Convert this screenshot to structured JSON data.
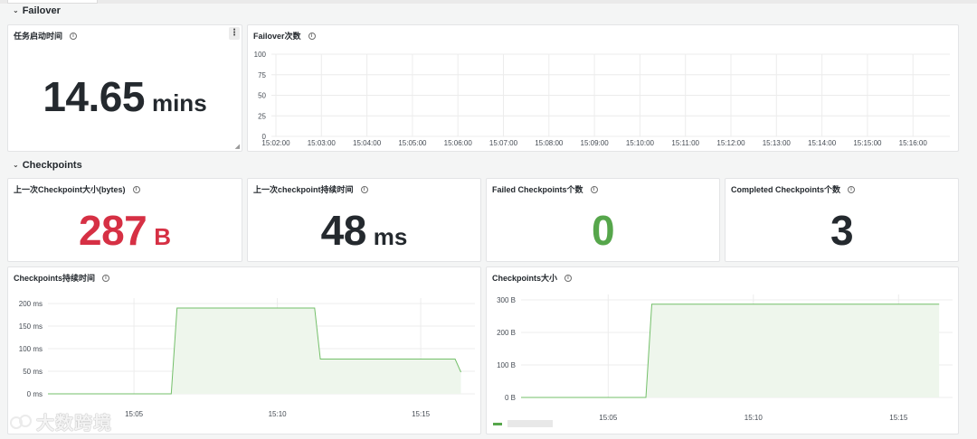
{
  "rows": {
    "failover": {
      "title": "Failover"
    },
    "checkpoints": {
      "title": "Checkpoints"
    }
  },
  "panels": {
    "job_start_time": {
      "title": "任务启动时间",
      "value": "14.65",
      "unit": "mins"
    },
    "failover_count": {
      "title": "Failover次数",
      "y_ticks": [
        "100",
        "75",
        "50",
        "25",
        "0"
      ],
      "x_ticks": [
        "15:02:00",
        "15:03:00",
        "15:04:00",
        "15:05:00",
        "15:06:00",
        "15:07:00",
        "15:08:00",
        "15:09:00",
        "15:10:00",
        "15:11:00",
        "15:12:00",
        "15:13:00",
        "15:14:00",
        "15:15:00",
        "15:16:00"
      ]
    },
    "last_cp_size": {
      "title": "上一次Checkpoint大小(bytes)",
      "value": "287",
      "unit": "B"
    },
    "last_cp_duration": {
      "title": "上一次checkpoint持续时间",
      "value": "48",
      "unit": "ms"
    },
    "failed_cps": {
      "title": "Failed Checkpoints个数",
      "value": "0"
    },
    "completed_cps": {
      "title": "Completed Checkpoints个数",
      "value": "3"
    },
    "cp_duration": {
      "title": "Checkpoints持续时间",
      "y_ticks": [
        "200 ms",
        "150 ms",
        "100 ms",
        "50 ms",
        "0 ms"
      ],
      "x_ticks": [
        "15:05",
        "15:10",
        "15:15"
      ]
    },
    "cp_size": {
      "title": "Checkpoints大小",
      "y_ticks": [
        "300 B",
        "200 B",
        "100 B",
        "0 B"
      ],
      "x_ticks": [
        "15:05",
        "15:10",
        "15:15"
      ]
    }
  },
  "colors": {
    "size_value": "#d63044",
    "failed_value": "#56a64b",
    "neutral_value": "#24292e",
    "series_line": "#73bf69",
    "series_fill": "#eef6ec"
  },
  "chart_data": [
    {
      "type": "line",
      "title": "Failover次数",
      "x": [
        "15:02:00",
        "15:03:00",
        "15:04:00",
        "15:05:00",
        "15:06:00",
        "15:07:00",
        "15:08:00",
        "15:09:00",
        "15:10:00",
        "15:11:00",
        "15:12:00",
        "15:13:00",
        "15:14:00",
        "15:15:00",
        "15:16:00"
      ],
      "series": [],
      "ylim": [
        0,
        100
      ],
      "grid": true
    },
    {
      "type": "area",
      "title": "Checkpoints持续时间",
      "x_minutes": [
        2.0,
        6.3,
        6.5,
        11.3,
        11.5,
        16.2,
        16.4
      ],
      "x_ref": "15:00",
      "values": [
        0,
        0,
        190,
        190,
        77,
        77,
        48
      ],
      "ylim": [
        0,
        200
      ],
      "yunit": "ms",
      "grid": true
    },
    {
      "type": "area",
      "title": "Checkpoints大小",
      "x_minutes": [
        2.0,
        6.3,
        6.5,
        16.4
      ],
      "x_ref": "15:00",
      "values": [
        0,
        0,
        287,
        287
      ],
      "ylim": [
        0,
        300
      ],
      "yunit": "B",
      "grid": true
    }
  ],
  "branding": {
    "logo_text": "大数跨境",
    "logo_badge": "OO"
  }
}
